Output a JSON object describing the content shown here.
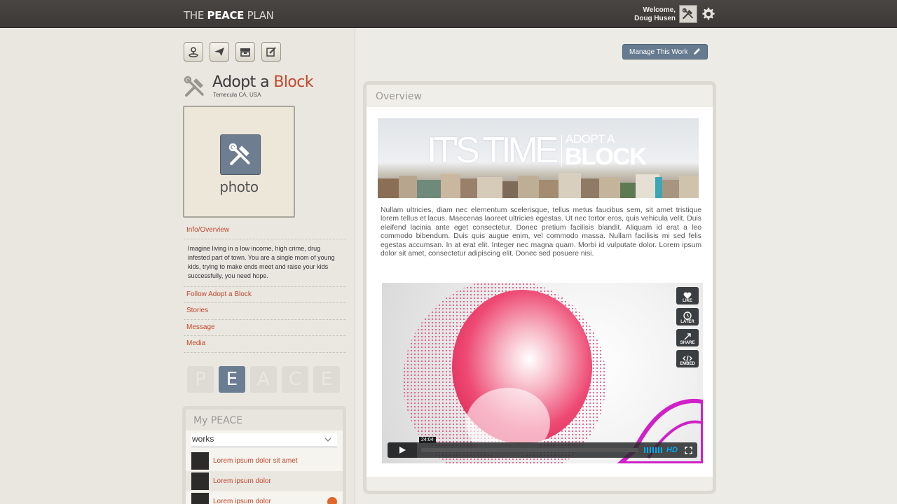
{
  "header": {
    "logo": {
      "part1": "THE ",
      "part2": "PEACE",
      "part3": " PLAN"
    },
    "welcome_line1": "Welcome,",
    "welcome_line2": "Doug Husen"
  },
  "work": {
    "title_part1": "Adopt a ",
    "title_part2": "Block",
    "location": "Temecula CA, USA",
    "photo_label": "photo"
  },
  "sidebar": {
    "links": [
      {
        "label": "Info/Overview"
      },
      {
        "label": "Follow Adopt a Block"
      },
      {
        "label": "Stories"
      },
      {
        "label": "Message"
      },
      {
        "label": "Media"
      }
    ],
    "description": "Imagine living in a low income, high crime, drug infested part of town. You are a single mom of young kids, trying to make ends meet and raise your kids successfully, you need hope."
  },
  "peace_letters": [
    "P",
    "E",
    "A",
    "C",
    "E"
  ],
  "peace_active_index": 1,
  "my_peace": {
    "heading": "My PEACE",
    "select_value": "works",
    "items": [
      {
        "name": "Lorem ipsum dolor sit amet"
      },
      {
        "name": "Lorem ipsum dolor"
      },
      {
        "name": "Lorem ipsum dolor"
      }
    ]
  },
  "main": {
    "manage_button": "Manage This Work",
    "overview_heading": "Overview",
    "banner": {
      "line1": "IT'S TIME",
      "line2": "ADOPT A",
      "line3": "BLOCK"
    },
    "paragraph": "Nullam ultricies, diam nec elementum scelerisque, tellus metus faucibus sem, sit amet tristique lorem tellus et lacus. Maecenas laoreet ultricies egestas. Ut nec tortor eros, quis vehicula velit. Duis eleifend lacinia ante eget consectetur. Donec pretium facilisis blandit. Aliquam id erat a leo commodo bibendum. Duis quis augue enim, vel commodo massa. Nullam facilisis mi sed felis egestas accumsan. In at erat elit. Integer nec magna quam. Morbi id vulputate dolor. Lorem ipsum dolor sit amet, consectetur adipiscing elit. Donec sed posuere nisi.",
    "video": {
      "time": "24:04",
      "side_buttons": [
        "LIKE",
        "LATER",
        "SHARE",
        "EMBED"
      ],
      "hd_label": "HD"
    }
  },
  "colors": {
    "accent": "#c0482b",
    "topbar": "#413d3b",
    "slate": "#667b8f",
    "vimeo_blue": "#00adef"
  }
}
